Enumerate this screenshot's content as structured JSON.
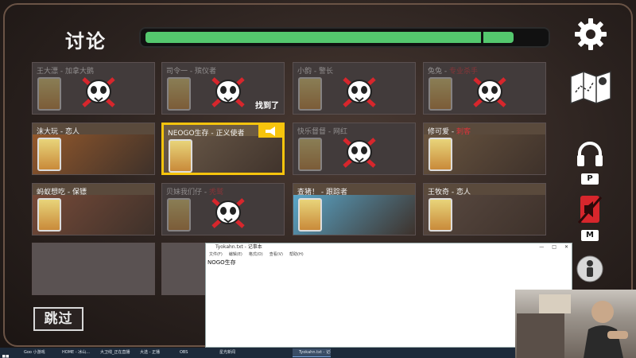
{
  "header": {
    "title": "讨论",
    "timer_progress": 0.92
  },
  "players": [
    {
      "name": "王大漂",
      "sep": " - ",
      "role": "加拿大鹅",
      "role_color": "normal",
      "status": "dead",
      "found_label": ""
    },
    {
      "name": "司令一",
      "sep": " - ",
      "role": "殡仪者",
      "role_color": "normal",
      "status": "dead",
      "found_label": "找到了"
    },
    {
      "name": "小韵",
      "sep": " - ",
      "role": "警长",
      "role_color": "normal",
      "status": "dead",
      "found_label": ""
    },
    {
      "name": "兔兔",
      "sep": " - ",
      "role": "专业杀手",
      "role_color": "red",
      "status": "dead",
      "found_label": ""
    },
    {
      "name": "沫大玩",
      "sep": " - ",
      "role": "恋人",
      "role_color": "normal",
      "status": "alive",
      "found_label": ""
    },
    {
      "name": "NEOGO生存",
      "sep": " - ",
      "role": "正义使者",
      "role_color": "normal",
      "status": "selected",
      "found_label": ""
    },
    {
      "name": "快乐督督",
      "sep": " - ",
      "role": "网红",
      "role_color": "normal",
      "status": "dead",
      "found_label": ""
    },
    {
      "name": "修可爱",
      "sep": " - ",
      "role": "刺客",
      "role_color": "red",
      "status": "alive",
      "found_label": ""
    },
    {
      "name": "蚂蚁想吃",
      "sep": " - ",
      "role": "保镖",
      "role_color": "normal",
      "status": "alive",
      "found_label": ""
    },
    {
      "name": "贝妹我们仔",
      "sep": " - ",
      "role": "秃鹫",
      "role_color": "red",
      "status": "dead",
      "found_label": ""
    },
    {
      "name": "查猪！",
      "sep": " - ",
      "role": "跟踪者",
      "role_color": "normal",
      "status": "alive",
      "found_label": ""
    },
    {
      "name": "王牧奇",
      "sep": " - ",
      "role": "恋人",
      "role_color": "normal",
      "status": "alive",
      "found_label": ""
    },
    {
      "name": "",
      "sep": "",
      "role": "",
      "role_color": "normal",
      "status": "empty",
      "found_label": ""
    },
    {
      "name": "",
      "sep": "",
      "role": "",
      "role_color": "normal",
      "status": "empty",
      "found_label": ""
    }
  ],
  "sidebar": {
    "mic_key": "P",
    "mute_key": "M"
  },
  "skip_label": "跳过",
  "notepad": {
    "title": "Tyokahn.txt - 记事本",
    "menu": [
      "文件(F)",
      "编辑(E)",
      "格式(O)",
      "查看(V)",
      "帮助(H)"
    ],
    "content": "NOGO生存"
  },
  "taskbar": {
    "items": [
      "Goo 小游戏",
      "HOME - 冰山...",
      "大卫线_正在直播...",
      "大选 - 正播",
      "OBS",
      "星光新闻",
      "Tyokahn.txt - 记事本"
    ]
  },
  "colors": {
    "timer": "#54c86e",
    "highlight": "#f6c40d",
    "role_red": "#e0333a"
  }
}
